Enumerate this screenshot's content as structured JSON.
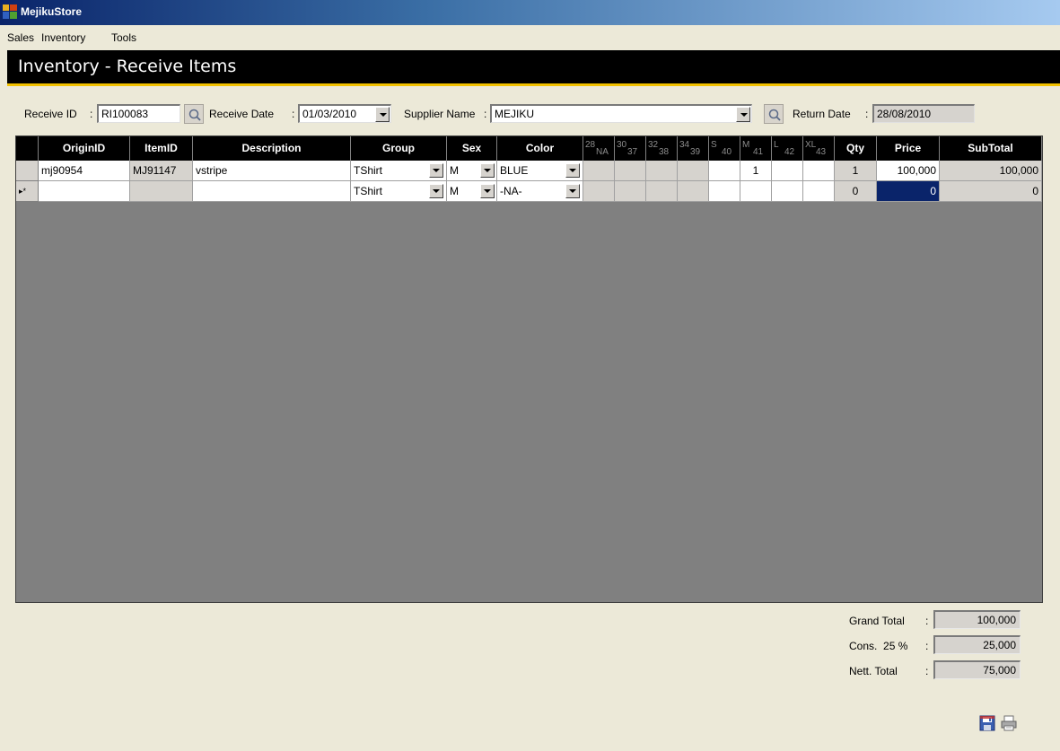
{
  "window": {
    "title": "MejikuStore"
  },
  "menu": {
    "items": [
      "Sales",
      "Inventory",
      "Tools"
    ]
  },
  "page": {
    "title": "Inventory - Receive Items"
  },
  "form": {
    "receive_id_label": "Receive ID",
    "receive_id_value": "RI100083",
    "receive_date_label": "Receive Date",
    "receive_date_value": "01/03/2010",
    "supplier_label": "Supplier Name",
    "supplier_value": "MEJIKU",
    "return_date_label": "Return Date",
    "return_date_value": "28/08/2010",
    "colon": ":"
  },
  "grid": {
    "headers": {
      "origin_id": "OriginID",
      "item_id": "ItemID",
      "description": "Description",
      "group": "Group",
      "sex": "Sex",
      "color": "Color",
      "qty": "Qty",
      "price": "Price",
      "subtotal": "SubTotal"
    },
    "size_headers": [
      {
        "top": "28",
        "bottom": "NA"
      },
      {
        "top": "30",
        "bottom": "37"
      },
      {
        "top": "32",
        "bottom": "38"
      },
      {
        "top": "34",
        "bottom": "39"
      },
      {
        "top": "S",
        "bottom": "40"
      },
      {
        "top": "M",
        "bottom": "41"
      },
      {
        "top": "L",
        "bottom": "42"
      },
      {
        "top": "XL",
        "bottom": "43"
      }
    ],
    "rows": [
      {
        "origin_id": "mj90954",
        "item_id": "MJ91147",
        "description": "vstripe",
        "group": "TShirt",
        "sex": "M",
        "color": "BLUE",
        "sizes": [
          "",
          "",
          "",
          "",
          "",
          "1",
          "",
          ""
        ],
        "qty": "1",
        "price": "100,000",
        "subtotal": "100,000"
      },
      {
        "origin_id": "",
        "item_id": "",
        "description": "",
        "group": "TShirt",
        "sex": "M",
        "color": "-NA-",
        "sizes": [
          "",
          "",
          "",
          "",
          "",
          "",
          "",
          ""
        ],
        "qty": "0",
        "price": "0",
        "subtotal": "0"
      }
    ],
    "new_row_marker": "▸*"
  },
  "totals": {
    "grand_total_label": "Grand Total",
    "grand_total_value": "100,000",
    "cons_label": "Cons.",
    "cons_percent": "25",
    "cons_percent_sign": "%",
    "cons_value": "25,000",
    "nett_total_label": "Nett. Total",
    "nett_total_value": "75,000"
  },
  "icons": {
    "save": "save-icon",
    "print": "print-icon",
    "lookup": "search-icon",
    "app": "app-icon"
  },
  "colors": {
    "header_band": "#000000",
    "header_accent": "#f2c100",
    "selection": "#0a246a"
  }
}
